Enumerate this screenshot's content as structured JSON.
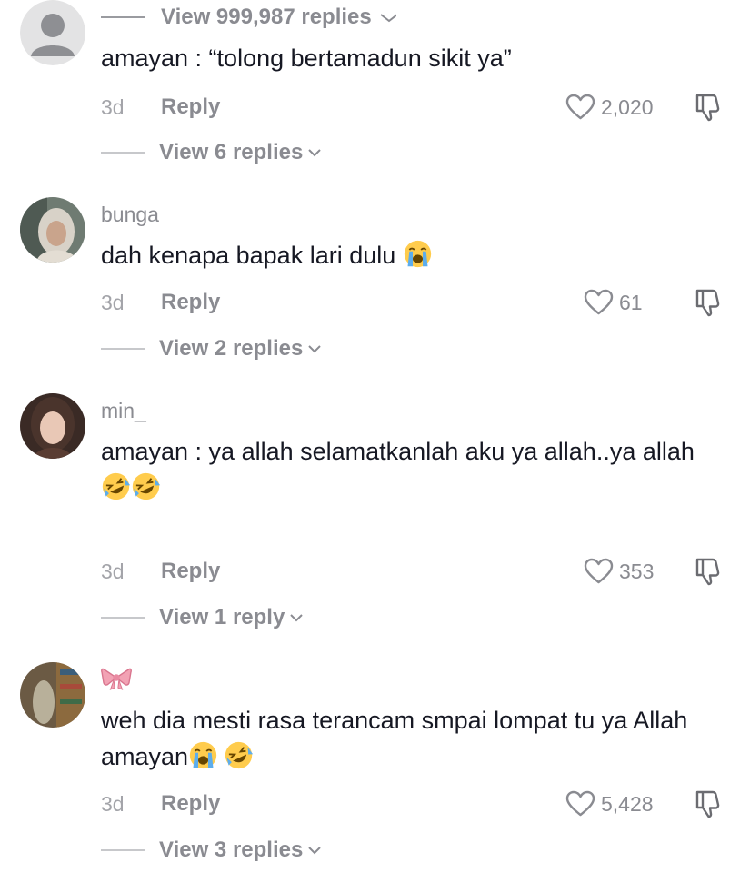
{
  "top_thread": {
    "view_replies_label": "View 999,987 replies"
  },
  "comments": [
    {
      "username": "",
      "text": "amayan : “tolong bertamadun sikit ya”",
      "emoji": [],
      "date": "3d",
      "reply_label": "Reply",
      "likes": "2,020",
      "view_replies_label": "View 6 replies"
    },
    {
      "username": "bunga",
      "text": "dah kenapa bapak lari dulu",
      "emoji": [
        "loudly-crying-face"
      ],
      "date": "3d",
      "reply_label": "Reply",
      "likes": "61",
      "view_replies_label": "View 2 replies"
    },
    {
      "username": "min_",
      "text": "amayan : ya allah selamatkanlah aku ya allah..ya allah",
      "emoji": [
        "rolling-on-floor-laughing",
        "rolling-on-floor-laughing"
      ],
      "date": "3d",
      "reply_label": "Reply",
      "likes": "353",
      "view_replies_label": "View 1 reply"
    },
    {
      "username": "🎀",
      "text": "weh dia mesti rasa terancam smpai lompat tu ya Allah amayan",
      "emoji": [
        "loudly-crying-face",
        "rolling-on-floor-laughing"
      ],
      "date": "3d",
      "reply_label": "Reply",
      "likes": "5,428",
      "view_replies_label": "View 3 replies"
    }
  ],
  "colors": {
    "text_primary": "#161823",
    "text_secondary": "#8a8b91",
    "divider": "#c7c8cb",
    "bow": "#f2a2b4"
  },
  "icons": [
    "heart-outline-icon",
    "thumbs-down-icon",
    "chevron-down-icon",
    "default-avatar-icon"
  ]
}
